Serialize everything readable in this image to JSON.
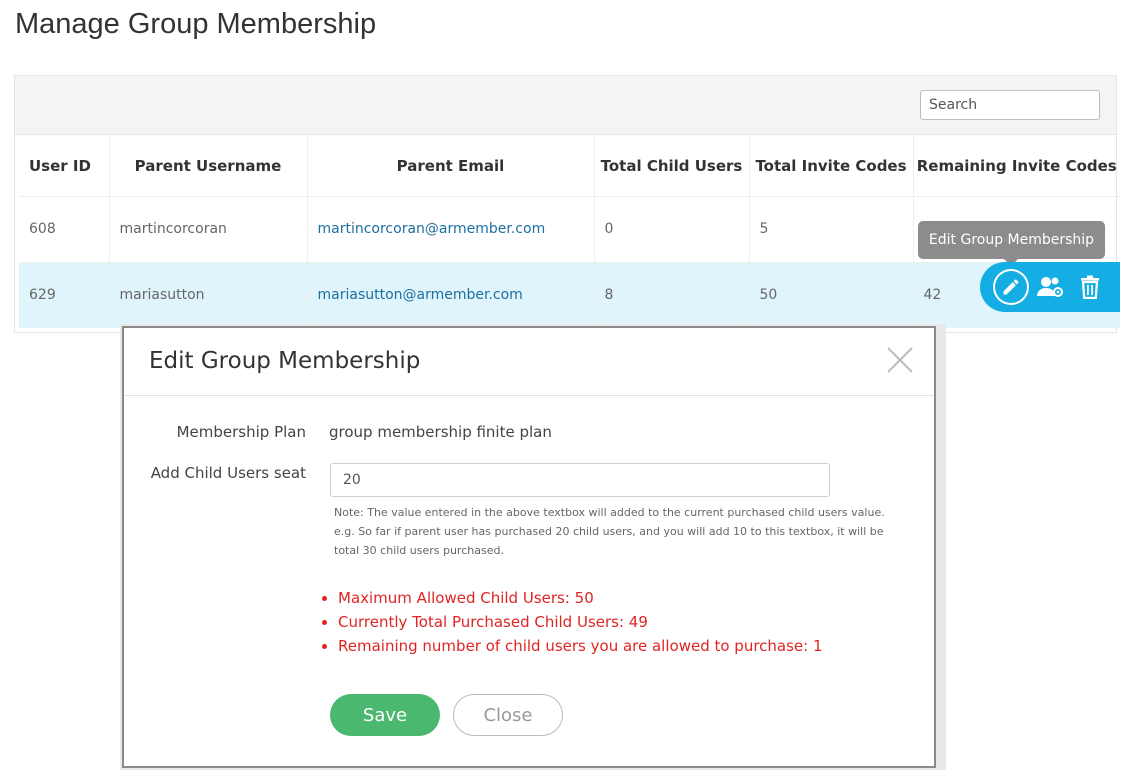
{
  "page": {
    "title": "Manage Group Membership"
  },
  "search": {
    "placeholder": "Search"
  },
  "table": {
    "columns": [
      "User ID",
      "Parent Username",
      "Parent Email",
      "Total Child Users",
      "Total Invite Codes",
      "Remaining Invite Codes"
    ],
    "rows": [
      {
        "user_id": "608",
        "username": "martincorcoran",
        "email": "martincorcoran@armember.com",
        "child_users": "0",
        "invite_codes": "5",
        "remaining": ""
      },
      {
        "user_id": "629",
        "username": "mariasutton",
        "email": "mariasutton@armember.com",
        "child_users": "8",
        "invite_codes": "50",
        "remaining": "42"
      }
    ]
  },
  "tooltip": {
    "text": "Edit Group Membership"
  },
  "actions": {
    "icons": [
      "pencil-icon",
      "users-icon",
      "trash-icon"
    ],
    "accent": "#15aee4"
  },
  "modal": {
    "title": "Edit Group Membership",
    "plan_label": "Membership Plan",
    "plan_value": "group membership finite plan",
    "seat_label": "Add Child Users seat",
    "seat_value": "20",
    "note": "Note: The value entered in the above textbox will added to the current purchased child users value. e.g. So far if parent user has purchased 20 child users, and you will add 10 to this textbox, it will be total 30 child users purchased.",
    "messages": [
      "Maximum Allowed Child Users: 50",
      "Currently Total Purchased Child Users: 49",
      "Remaining number of child users you are allowed to purchase: 1"
    ],
    "save_label": "Save",
    "close_label": "Close"
  }
}
